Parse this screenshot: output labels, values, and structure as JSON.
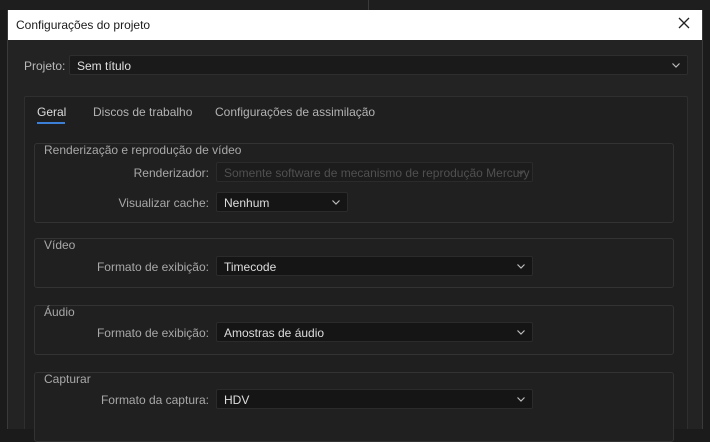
{
  "dialog": {
    "title": "Configurações do projeto"
  },
  "project": {
    "label": "Projeto:",
    "value": "Sem título"
  },
  "tabs": [
    {
      "label": "Geral",
      "active": true
    },
    {
      "label": "Discos de trabalho",
      "active": false
    },
    {
      "label": "Configurações de assimilação",
      "active": false
    }
  ],
  "sections": {
    "render": {
      "title": "Renderização e reprodução de vídeo",
      "renderer_label": "Renderizador:",
      "renderer_value": "Somente software de mecanismo de reprodução Mercury",
      "renderer_disabled": true,
      "cache_label": "Visualizar cache:",
      "cache_value": "Nenhum"
    },
    "video": {
      "title": "Vídeo",
      "format_label": "Formato de exibição:",
      "format_value": "Timecode"
    },
    "audio": {
      "title": "Áudio",
      "format_label": "Formato de exibição:",
      "format_value": "Amostras de áudio"
    },
    "capture": {
      "title": "Capturar",
      "format_label": "Formato da captura:",
      "format_value": "HDV"
    }
  },
  "colors": {
    "accent": "#3b7fd6",
    "background": "#232323",
    "titlebar": "#ffffff"
  },
  "icons": {
    "close": "close-icon",
    "dropdown": "chevron-down-icon"
  }
}
